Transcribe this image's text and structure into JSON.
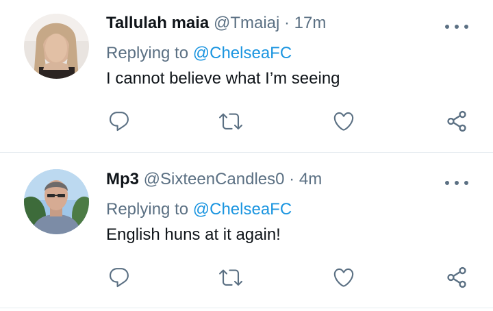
{
  "tweets": [
    {
      "display_name": "Tallulah maia",
      "handle": "@Tmaiaj",
      "separator": "·",
      "time": "17m",
      "replying_prefix": "Replying to",
      "replying_to": "@ChelseaFC",
      "text": "I cannot believe what I’m seeing"
    },
    {
      "display_name": "Mp3",
      "handle": "@SixteenCandles0",
      "separator": "·",
      "time": "4m",
      "replying_prefix": "Replying to",
      "replying_to": "@ChelseaFC",
      "text": "English huns at it again!"
    }
  ],
  "icons": {
    "reply": "reply-icon",
    "retweet": "retweet-icon",
    "like": "heart-icon",
    "share": "share-icon",
    "more": "more-icon"
  },
  "colors": {
    "text": "#0f1419",
    "secondary": "#5b7083",
    "link": "#1b95e0",
    "divider": "#e6ecf0"
  }
}
